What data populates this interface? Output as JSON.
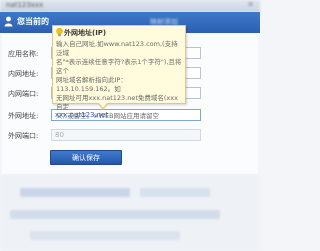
{
  "window": {
    "title": "nat123xxx"
  },
  "nav": {
    "current_label": "您当前的",
    "right_text": "映射添加"
  },
  "form": {
    "rows": [
      {
        "label": "应用名称:",
        "value": ""
      },
      {
        "label": "内网地址:",
        "value": ""
      },
      {
        "label": "内网端口:",
        "value": ""
      },
      {
        "label": "外网地址:",
        "value": "xxx.nat123.net"
      },
      {
        "label": "外网端口:",
        "value": "80"
      }
    ],
    "save_label": "确认保存"
  },
  "tooltip": {
    "title": "外网地址(IP)",
    "body": "输入自己网址,如www.nat123.com,(支持泛域\n名\"*表示连续任意字符?表示1个字符\"),且将这个\n网址域名解析指向此IP：113.10.159.162。如\n无网址可用xxx.nat123.net免费域名(xxx自定\n义),或留空。※WEB网站应用请留空"
  },
  "colors": {
    "accent": "#2c5fae",
    "tooltip_bg": "#fffbdc"
  }
}
